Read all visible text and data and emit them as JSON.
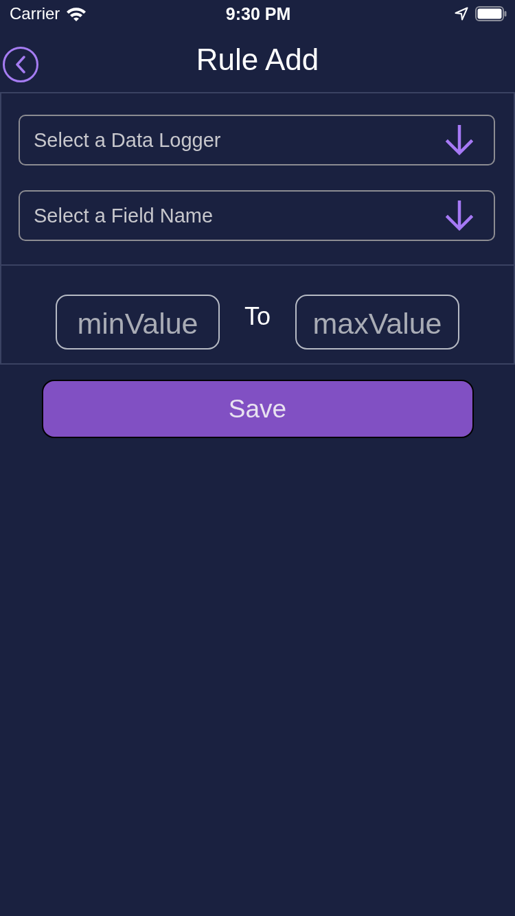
{
  "status_bar": {
    "carrier": "Carrier",
    "time": "9:30 PM"
  },
  "nav_bar": {
    "title": "Rule Add"
  },
  "dropdowns": [
    {
      "placeholder": "Select a Data Logger"
    },
    {
      "placeholder": "Select a Field Name"
    }
  ],
  "range": {
    "min": {
      "placeholder": "minValue"
    },
    "separator": "To",
    "max": {
      "placeholder": "maxValue"
    }
  },
  "buttons": [
    {
      "label": "Save"
    }
  ]
}
